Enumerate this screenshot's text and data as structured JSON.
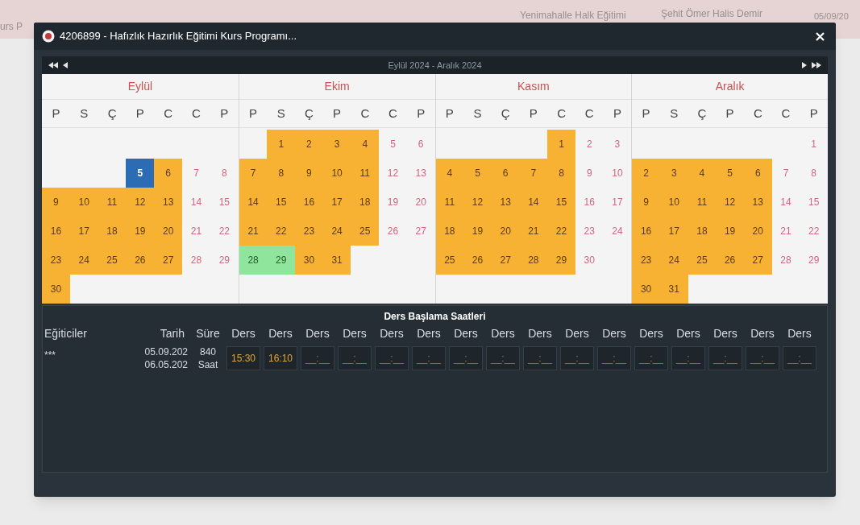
{
  "background_row": [
    "urs P",
    "Yenimahalle Halk Eğitimi",
    "Şehit Ömer Halis Demir",
    "05/09/20"
  ],
  "window": {
    "title": "4206899 - Hafızlık Hazırlık Eğitimi Kurs Programı..."
  },
  "calendar": {
    "range": "Eylül 2024 - Aralık 2024",
    "months": [
      {
        "name": "Eylül",
        "weekdays": [
          "P",
          "S",
          "Ç",
          "P",
          "C",
          "C",
          "P"
        ],
        "weeks": [
          [
            {
              "kind": "blank"
            },
            {
              "kind": "blank"
            },
            {
              "kind": "blank"
            },
            {
              "kind": "blank"
            },
            {
              "kind": "blank"
            },
            {
              "kind": "blank"
            },
            {
              "kind": "blank"
            }
          ],
          [
            {
              "kind": "blank"
            },
            {
              "kind": "blank"
            },
            {
              "kind": "blank"
            },
            {
              "d": "5",
              "kind": "start"
            },
            {
              "d": "6",
              "kind": "course"
            },
            {
              "d": "7",
              "kind": "off"
            },
            {
              "d": "8",
              "kind": "off"
            }
          ],
          [
            {
              "d": "9",
              "kind": "course"
            },
            {
              "d": "10",
              "kind": "course"
            },
            {
              "d": "11",
              "kind": "course"
            },
            {
              "d": "12",
              "kind": "course"
            },
            {
              "d": "13",
              "kind": "course"
            },
            {
              "d": "14",
              "kind": "off"
            },
            {
              "d": "15",
              "kind": "off"
            }
          ],
          [
            {
              "d": "16",
              "kind": "course"
            },
            {
              "d": "17",
              "kind": "course"
            },
            {
              "d": "18",
              "kind": "course"
            },
            {
              "d": "19",
              "kind": "course"
            },
            {
              "d": "20",
              "kind": "course"
            },
            {
              "d": "21",
              "kind": "off"
            },
            {
              "d": "22",
              "kind": "off"
            }
          ],
          [
            {
              "d": "23",
              "kind": "course"
            },
            {
              "d": "24",
              "kind": "course"
            },
            {
              "d": "25",
              "kind": "course"
            },
            {
              "d": "26",
              "kind": "course"
            },
            {
              "d": "27",
              "kind": "course"
            },
            {
              "d": "28",
              "kind": "off"
            },
            {
              "d": "29",
              "kind": "off"
            }
          ],
          [
            {
              "d": "30",
              "kind": "course"
            },
            {
              "kind": "blank"
            },
            {
              "kind": "blank"
            },
            {
              "kind": "blank"
            },
            {
              "kind": "blank"
            },
            {
              "kind": "blank"
            },
            {
              "kind": "blank"
            }
          ]
        ]
      },
      {
        "name": "Ekim",
        "weekdays": [
          "P",
          "S",
          "Ç",
          "P",
          "C",
          "C",
          "P"
        ],
        "weeks": [
          [
            {
              "kind": "blank"
            },
            {
              "d": "1",
              "kind": "course"
            },
            {
              "d": "2",
              "kind": "course"
            },
            {
              "d": "3",
              "kind": "course"
            },
            {
              "d": "4",
              "kind": "course"
            },
            {
              "d": "5",
              "kind": "off"
            },
            {
              "d": "6",
              "kind": "off"
            }
          ],
          [
            {
              "d": "7",
              "kind": "course"
            },
            {
              "d": "8",
              "kind": "course"
            },
            {
              "d": "9",
              "kind": "course"
            },
            {
              "d": "10",
              "kind": "course"
            },
            {
              "d": "11",
              "kind": "course"
            },
            {
              "d": "12",
              "kind": "off"
            },
            {
              "d": "13",
              "kind": "off"
            }
          ],
          [
            {
              "d": "14",
              "kind": "course"
            },
            {
              "d": "15",
              "kind": "course"
            },
            {
              "d": "16",
              "kind": "course"
            },
            {
              "d": "17",
              "kind": "course"
            },
            {
              "d": "18",
              "kind": "course"
            },
            {
              "d": "19",
              "kind": "off"
            },
            {
              "d": "20",
              "kind": "off"
            }
          ],
          [
            {
              "d": "21",
              "kind": "course"
            },
            {
              "d": "22",
              "kind": "course"
            },
            {
              "d": "23",
              "kind": "course"
            },
            {
              "d": "24",
              "kind": "course"
            },
            {
              "d": "25",
              "kind": "course"
            },
            {
              "d": "26",
              "kind": "off"
            },
            {
              "d": "27",
              "kind": "off"
            }
          ],
          [
            {
              "d": "28",
              "kind": "today"
            },
            {
              "d": "29",
              "kind": "today"
            },
            {
              "d": "30",
              "kind": "course"
            },
            {
              "d": "31",
              "kind": "course"
            },
            {
              "kind": "blank"
            },
            {
              "kind": "blank"
            },
            {
              "kind": "blank"
            }
          ]
        ]
      },
      {
        "name": "Kasım",
        "weekdays": [
          "P",
          "S",
          "Ç",
          "P",
          "C",
          "C",
          "P"
        ],
        "weeks": [
          [
            {
              "kind": "blank"
            },
            {
              "kind": "blank"
            },
            {
              "kind": "blank"
            },
            {
              "kind": "blank"
            },
            {
              "d": "1",
              "kind": "course"
            },
            {
              "d": "2",
              "kind": "off"
            },
            {
              "d": "3",
              "kind": "off"
            }
          ],
          [
            {
              "d": "4",
              "kind": "course"
            },
            {
              "d": "5",
              "kind": "course"
            },
            {
              "d": "6",
              "kind": "course"
            },
            {
              "d": "7",
              "kind": "course"
            },
            {
              "d": "8",
              "kind": "course"
            },
            {
              "d": "9",
              "kind": "off"
            },
            {
              "d": "10",
              "kind": "off"
            }
          ],
          [
            {
              "d": "11",
              "kind": "course"
            },
            {
              "d": "12",
              "kind": "course"
            },
            {
              "d": "13",
              "kind": "course"
            },
            {
              "d": "14",
              "kind": "course"
            },
            {
              "d": "15",
              "kind": "course"
            },
            {
              "d": "16",
              "kind": "off"
            },
            {
              "d": "17",
              "kind": "off"
            }
          ],
          [
            {
              "d": "18",
              "kind": "course"
            },
            {
              "d": "19",
              "kind": "course"
            },
            {
              "d": "20",
              "kind": "course"
            },
            {
              "d": "21",
              "kind": "course"
            },
            {
              "d": "22",
              "kind": "course"
            },
            {
              "d": "23",
              "kind": "off"
            },
            {
              "d": "24",
              "kind": "off"
            }
          ],
          [
            {
              "d": "25",
              "kind": "course"
            },
            {
              "d": "26",
              "kind": "course"
            },
            {
              "d": "27",
              "kind": "course"
            },
            {
              "d": "28",
              "kind": "course"
            },
            {
              "d": "29",
              "kind": "course"
            },
            {
              "d": "30",
              "kind": "off"
            },
            {
              "kind": "blank"
            }
          ]
        ]
      },
      {
        "name": "Aralık",
        "weekdays": [
          "P",
          "S",
          "Ç",
          "P",
          "C",
          "C",
          "P"
        ],
        "weeks": [
          [
            {
              "kind": "blank"
            },
            {
              "kind": "blank"
            },
            {
              "kind": "blank"
            },
            {
              "kind": "blank"
            },
            {
              "kind": "blank"
            },
            {
              "kind": "blank"
            },
            {
              "d": "1",
              "kind": "off"
            }
          ],
          [
            {
              "d": "2",
              "kind": "course"
            },
            {
              "d": "3",
              "kind": "course"
            },
            {
              "d": "4",
              "kind": "course"
            },
            {
              "d": "5",
              "kind": "course"
            },
            {
              "d": "6",
              "kind": "course"
            },
            {
              "d": "7",
              "kind": "off"
            },
            {
              "d": "8",
              "kind": "off"
            }
          ],
          [
            {
              "d": "9",
              "kind": "course"
            },
            {
              "d": "10",
              "kind": "course"
            },
            {
              "d": "11",
              "kind": "course"
            },
            {
              "d": "12",
              "kind": "course"
            },
            {
              "d": "13",
              "kind": "course"
            },
            {
              "d": "14",
              "kind": "off"
            },
            {
              "d": "15",
              "kind": "off"
            }
          ],
          [
            {
              "d": "16",
              "kind": "course"
            },
            {
              "d": "17",
              "kind": "course"
            },
            {
              "d": "18",
              "kind": "course"
            },
            {
              "d": "19",
              "kind": "course"
            },
            {
              "d": "20",
              "kind": "course"
            },
            {
              "d": "21",
              "kind": "off"
            },
            {
              "d": "22",
              "kind": "off"
            }
          ],
          [
            {
              "d": "23",
              "kind": "course"
            },
            {
              "d": "24",
              "kind": "course"
            },
            {
              "d": "25",
              "kind": "course"
            },
            {
              "d": "26",
              "kind": "course"
            },
            {
              "d": "27",
              "kind": "course"
            },
            {
              "d": "28",
              "kind": "off"
            },
            {
              "d": "29",
              "kind": "off"
            }
          ],
          [
            {
              "d": "30",
              "kind": "course"
            },
            {
              "d": "31",
              "kind": "course"
            },
            {
              "kind": "blank"
            },
            {
              "kind": "blank"
            },
            {
              "kind": "blank"
            },
            {
              "kind": "blank"
            },
            {
              "kind": "blank"
            }
          ]
        ]
      }
    ]
  },
  "schedule": {
    "title": "Ders Başlama Saatleri",
    "columns": [
      "Eğiticiler",
      "Tarih",
      "Süre",
      "Ders",
      "Ders",
      "Ders",
      "Ders",
      "Ders",
      "Ders",
      "Ders",
      "Ders",
      "Ders",
      "Ders",
      "Ders",
      "Ders",
      "Ders",
      "Ders",
      "Ders",
      "Ders"
    ],
    "rows": [
      {
        "trainer": "***",
        "dates": [
          "05.09.202",
          "06.05.202"
        ],
        "duration": [
          "840",
          "Saat"
        ],
        "times": [
          {
            "value": "15:30"
          },
          {
            "value": "16:10"
          },
          {
            "placeholder": "__:__"
          },
          {
            "placeholder": "__:__"
          },
          {
            "placeholder": "__:__"
          },
          {
            "placeholder": "__:__"
          },
          {
            "placeholder": "__:__"
          },
          {
            "placeholder": "__:__"
          },
          {
            "placeholder": "__:__"
          },
          {
            "placeholder": "__:__"
          },
          {
            "placeholder": "__:__"
          },
          {
            "placeholder": "__:__"
          },
          {
            "placeholder": "__:__"
          },
          {
            "placeholder": "__:__"
          },
          {
            "placeholder": "__:__"
          },
          {
            "placeholder": "__:__"
          }
        ]
      }
    ]
  }
}
